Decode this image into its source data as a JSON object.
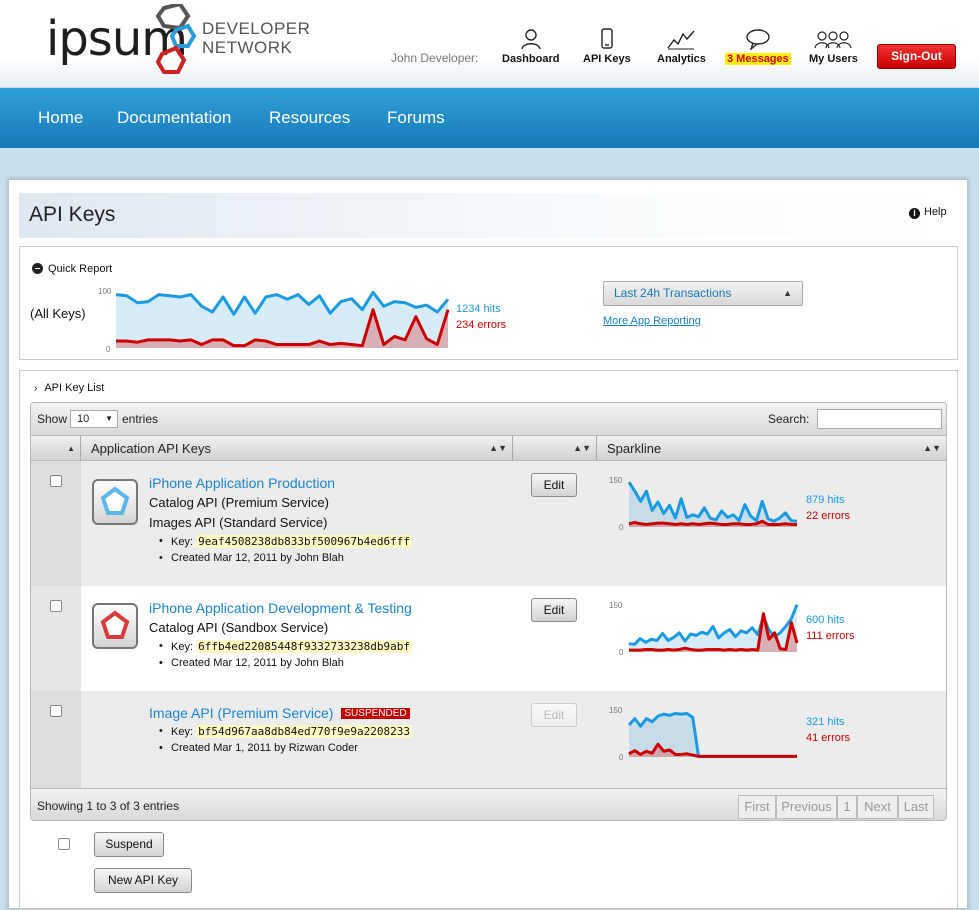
{
  "brand": {
    "word": "ipsum",
    "line1": "DEVELOPER",
    "line2": "NETWORK"
  },
  "header": {
    "user": "John Developer:",
    "nav": [
      {
        "label": "Dashboard",
        "icon": "person-icon"
      },
      {
        "label": "API Keys",
        "icon": "phone-icon"
      },
      {
        "label": "Analytics",
        "icon": "chart-icon"
      },
      {
        "label": "3 Messages",
        "icon": "speech-bubble-icon"
      },
      {
        "label": "My Users",
        "icon": "group-icon"
      }
    ],
    "signout": "Sign-Out"
  },
  "mainnav": [
    "Home",
    "Documentation",
    "Resources",
    "Forums"
  ],
  "page": {
    "title": "API Keys",
    "help": "Help"
  },
  "quick_report": {
    "title": "Quick Report",
    "label": "(All Keys)",
    "axis_max": "100",
    "axis_min": "0",
    "hits": "1234 hits",
    "errors": "234 errors",
    "range_select": "Last 24h Transactions",
    "more_link": "More App Reporting",
    "hits_series": [
      92,
      90,
      78,
      80,
      92,
      90,
      88,
      92,
      72,
      62,
      88,
      58,
      88,
      60,
      88,
      92,
      84,
      92,
      75,
      90,
      60,
      80,
      85,
      66,
      96,
      72,
      80,
      78,
      70,
      74,
      62,
      84
    ],
    "errors_series": [
      12,
      12,
      10,
      14,
      14,
      14,
      12,
      14,
      6,
      14,
      14,
      4,
      4,
      14,
      12,
      6,
      6,
      6,
      6,
      12,
      6,
      8,
      6,
      4,
      66,
      6,
      20,
      14,
      54,
      16,
      6,
      66
    ]
  },
  "key_list": {
    "title": "API Key List",
    "show_label": "Show",
    "show_value": "10",
    "entries_label": "entries",
    "search_label": "Search:",
    "search_value": "",
    "columns": [
      "Application API Keys",
      "",
      "Sparkline"
    ],
    "rows": [
      {
        "name": "iPhone Application Production",
        "services": [
          "Catalog API (Premium Service)",
          "Images API (Standard Service)"
        ],
        "key_label": "Key:",
        "key": "9eaf4508238db833bf500967b4ed6fff",
        "created": "Created Mar 12, 2011 by John Blah",
        "edit": "Edit",
        "status": "",
        "axis_max": "150",
        "axis_min": "0",
        "hits": "879 hits",
        "errors": "22 errors",
        "icon_color": "#5bb7e8",
        "hits_series": [
          140,
          112,
          80,
          112,
          52,
          78,
          42,
          68,
          28,
          88,
          30,
          38,
          32,
          60,
          28,
          22,
          50,
          30,
          38,
          20,
          70,
          34,
          20,
          80,
          26,
          18,
          28,
          44,
          20,
          18
        ],
        "errors_series": [
          10,
          14,
          10,
          8,
          10,
          12,
          12,
          10,
          8,
          10,
          8,
          10,
          8,
          10,
          12,
          10,
          8,
          8,
          10,
          10,
          8,
          8,
          10,
          18,
          8,
          8,
          8,
          10,
          8,
          8
        ]
      },
      {
        "name": "iPhone Application Development & Testing",
        "services": [
          "Catalog API (Sandbox Service)"
        ],
        "key_label": "Key:",
        "key": "6ffb4ed22085448f9332733238db9abf",
        "created": "Created Mar 12, 2011 by John Blah",
        "edit": "Edit",
        "status": "",
        "axis_max": "150",
        "axis_min": "0",
        "hits": "600 hits",
        "errors": "111 errors",
        "icon_color": "#d93a3a",
        "hits_series": [
          26,
          24,
          42,
          30,
          40,
          36,
          58,
          36,
          46,
          60,
          34,
          56,
          52,
          62,
          56,
          80,
          44,
          60,
          70,
          48,
          66,
          60,
          76,
          54,
          110,
          68,
          48,
          60,
          80,
          104,
          148
        ],
        "errors_series": [
          6,
          6,
          6,
          8,
          8,
          6,
          6,
          8,
          6,
          8,
          12,
          8,
          6,
          6,
          8,
          8,
          8,
          6,
          8,
          6,
          8,
          6,
          8,
          6,
          120,
          40,
          60,
          10,
          8,
          92,
          28
        ]
      },
      {
        "name": "Image API (Premium Service)",
        "services": [],
        "key_label": "Key:",
        "key": "bf54d967aa8db84ed770f9e9a2208233",
        "created": "Created Mar 1, 2011 by Rizwan Coder",
        "edit": "Edit",
        "status": "SUSPENDED",
        "axis_max": "150",
        "axis_min": "0",
        "hits": "321 hits",
        "errors": "41 errors",
        "icon_color": "",
        "hits_series": [
          100,
          120,
          96,
          120,
          110,
          128,
          134,
          130,
          136,
          134,
          136,
          124,
          2,
          2,
          2,
          2,
          2,
          2,
          2,
          2,
          2,
          2,
          2,
          2,
          2,
          2,
          2,
          2,
          2,
          2
        ],
        "errors_series": [
          10,
          20,
          8,
          18,
          12,
          40,
          18,
          22,
          8,
          8,
          10,
          6,
          2,
          2,
          2,
          2,
          2,
          2,
          2,
          2,
          2,
          2,
          2,
          2,
          2,
          2,
          2,
          2,
          2,
          2
        ]
      }
    ],
    "summary": "Showing 1 to 3 of 3 entries",
    "pagination": [
      "First",
      "Previous",
      "1",
      "Next",
      "Last"
    ],
    "suspend_button": "Suspend",
    "new_button": "New API Key"
  },
  "colors": {
    "accent": "#1a84d0",
    "hits": "#1a9ae0",
    "errors": "#cc0000",
    "nav": "#1f8bc9"
  }
}
